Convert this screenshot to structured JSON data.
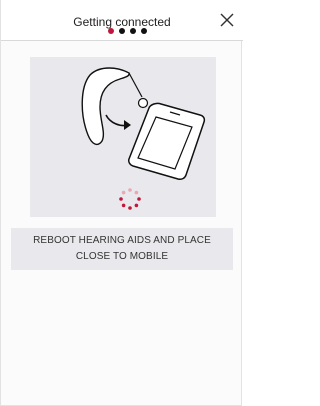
{
  "header": {
    "title": "Getting connected",
    "close_icon": "close-icon",
    "progress": {
      "total_steps": 4,
      "current_step": 1
    }
  },
  "illustration": {
    "icons": [
      "hearing-aid-icon",
      "arrow-icon",
      "mobile-phone-icon",
      "loading-spinner-icon"
    ]
  },
  "instruction": {
    "text": "REBOOT HEARING AIDS AND PLACE CLOSE TO MOBILE"
  },
  "colors": {
    "accent": "#c0183a",
    "panel_bg": "#e9e8ec",
    "text": "#333333"
  }
}
